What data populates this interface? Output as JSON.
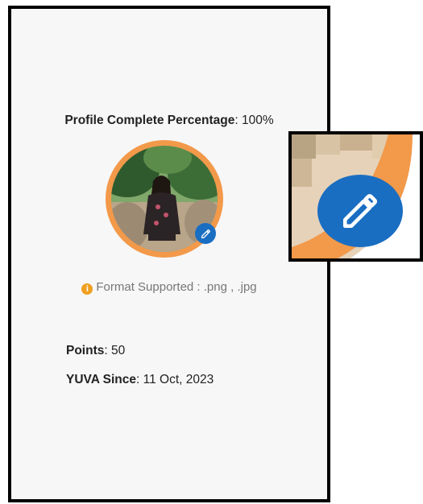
{
  "profile": {
    "completion_label": "Profile Complete Percentage",
    "completion_value": "100%",
    "avatar_alt": "Profile photo",
    "format_note": "Format Supported : .png , .jpg",
    "points_label": "Points",
    "points_value": "50",
    "since_label": "YUVA Since",
    "since_value": "11 Oct, 2023"
  },
  "icons": {
    "edit": "pencil-icon",
    "info": "info-icon"
  },
  "colors": {
    "accent_ring": "#f2994a",
    "edit_button": "#1a6ec2",
    "info_icon": "#f0a020"
  }
}
